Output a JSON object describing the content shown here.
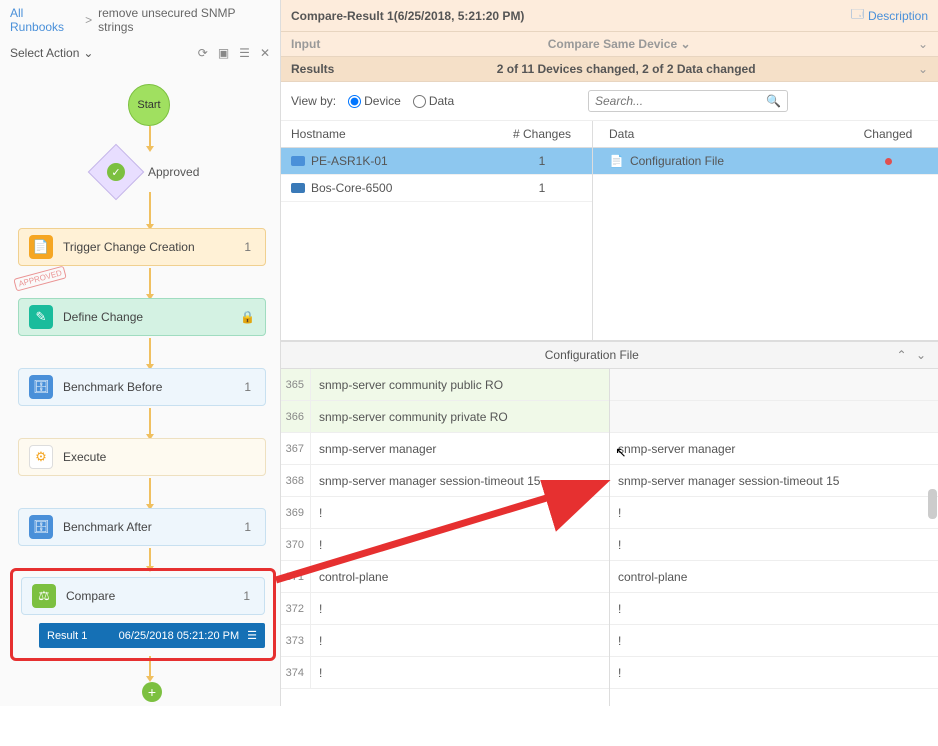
{
  "breadcrumb": {
    "root": "All Runbooks",
    "current": "remove unsecured SNMP strings"
  },
  "action_bar": {
    "select_label": "Select Action"
  },
  "flow": {
    "start": "Start",
    "approved": "Approved",
    "trigger": {
      "label": "Trigger Change Creation",
      "count": "1"
    },
    "approved_stamp": "APPROVED",
    "define": {
      "label": "Define Change"
    },
    "bench_before": {
      "label": "Benchmark Before",
      "count": "1"
    },
    "execute": {
      "label": "Execute"
    },
    "bench_after": {
      "label": "Benchmark After",
      "count": "1"
    },
    "compare": {
      "label": "Compare",
      "count": "1"
    },
    "result": {
      "label": "Result 1",
      "time": "06/25/2018 05:21:20 PM"
    }
  },
  "right": {
    "title": "Compare-Result 1(6/25/2018, 5:21:20 PM)",
    "description": "Description",
    "input_label": "Input",
    "compare_device": "Compare Same Device",
    "results_label": "Results",
    "results_summary": "2 of 11 Devices changed,  2 of 2 Data changed",
    "viewby": {
      "label": "View by:",
      "opt_device": "Device",
      "opt_data": "Data"
    },
    "search_placeholder": "Search...",
    "grid": {
      "hostname_hdr": "Hostname",
      "changes_hdr": "# Changes",
      "data_hdr": "Data",
      "changed_hdr": "Changed",
      "rows": [
        {
          "host": "PE-ASR1K-01",
          "changes": "1",
          "data": "Configuration File"
        },
        {
          "host": "Bos-Core-6500",
          "changes": "1"
        }
      ]
    },
    "config_title": "Configuration File",
    "diff": {
      "left": [
        {
          "no": "365",
          "txt": "snmp-server community public RO",
          "cls": "green"
        },
        {
          "no": "366",
          "txt": "snmp-server community private RO",
          "cls": "green"
        },
        {
          "no": "367",
          "txt": "snmp-server manager",
          "cls": ""
        },
        {
          "no": "368",
          "txt": "snmp-server manager session-timeout 15",
          "cls": ""
        },
        {
          "no": "369",
          "txt": "!",
          "cls": ""
        },
        {
          "no": "370",
          "txt": "!",
          "cls": ""
        },
        {
          "no": "371",
          "txt": "control-plane",
          "cls": ""
        },
        {
          "no": "372",
          "txt": "!",
          "cls": ""
        },
        {
          "no": "373",
          "txt": "!",
          "cls": ""
        },
        {
          "no": "374",
          "txt": "!",
          "cls": ""
        }
      ],
      "right": [
        {
          "txt": "",
          "cls": "gap"
        },
        {
          "txt": "",
          "cls": "gap"
        },
        {
          "txt": "snmp-server manager",
          "cls": ""
        },
        {
          "txt": "snmp-server manager session-timeout 15",
          "cls": ""
        },
        {
          "txt": "!",
          "cls": ""
        },
        {
          "txt": "!",
          "cls": ""
        },
        {
          "txt": "control-plane",
          "cls": ""
        },
        {
          "txt": "!",
          "cls": ""
        },
        {
          "txt": "!",
          "cls": ""
        },
        {
          "txt": "!",
          "cls": ""
        }
      ]
    }
  }
}
